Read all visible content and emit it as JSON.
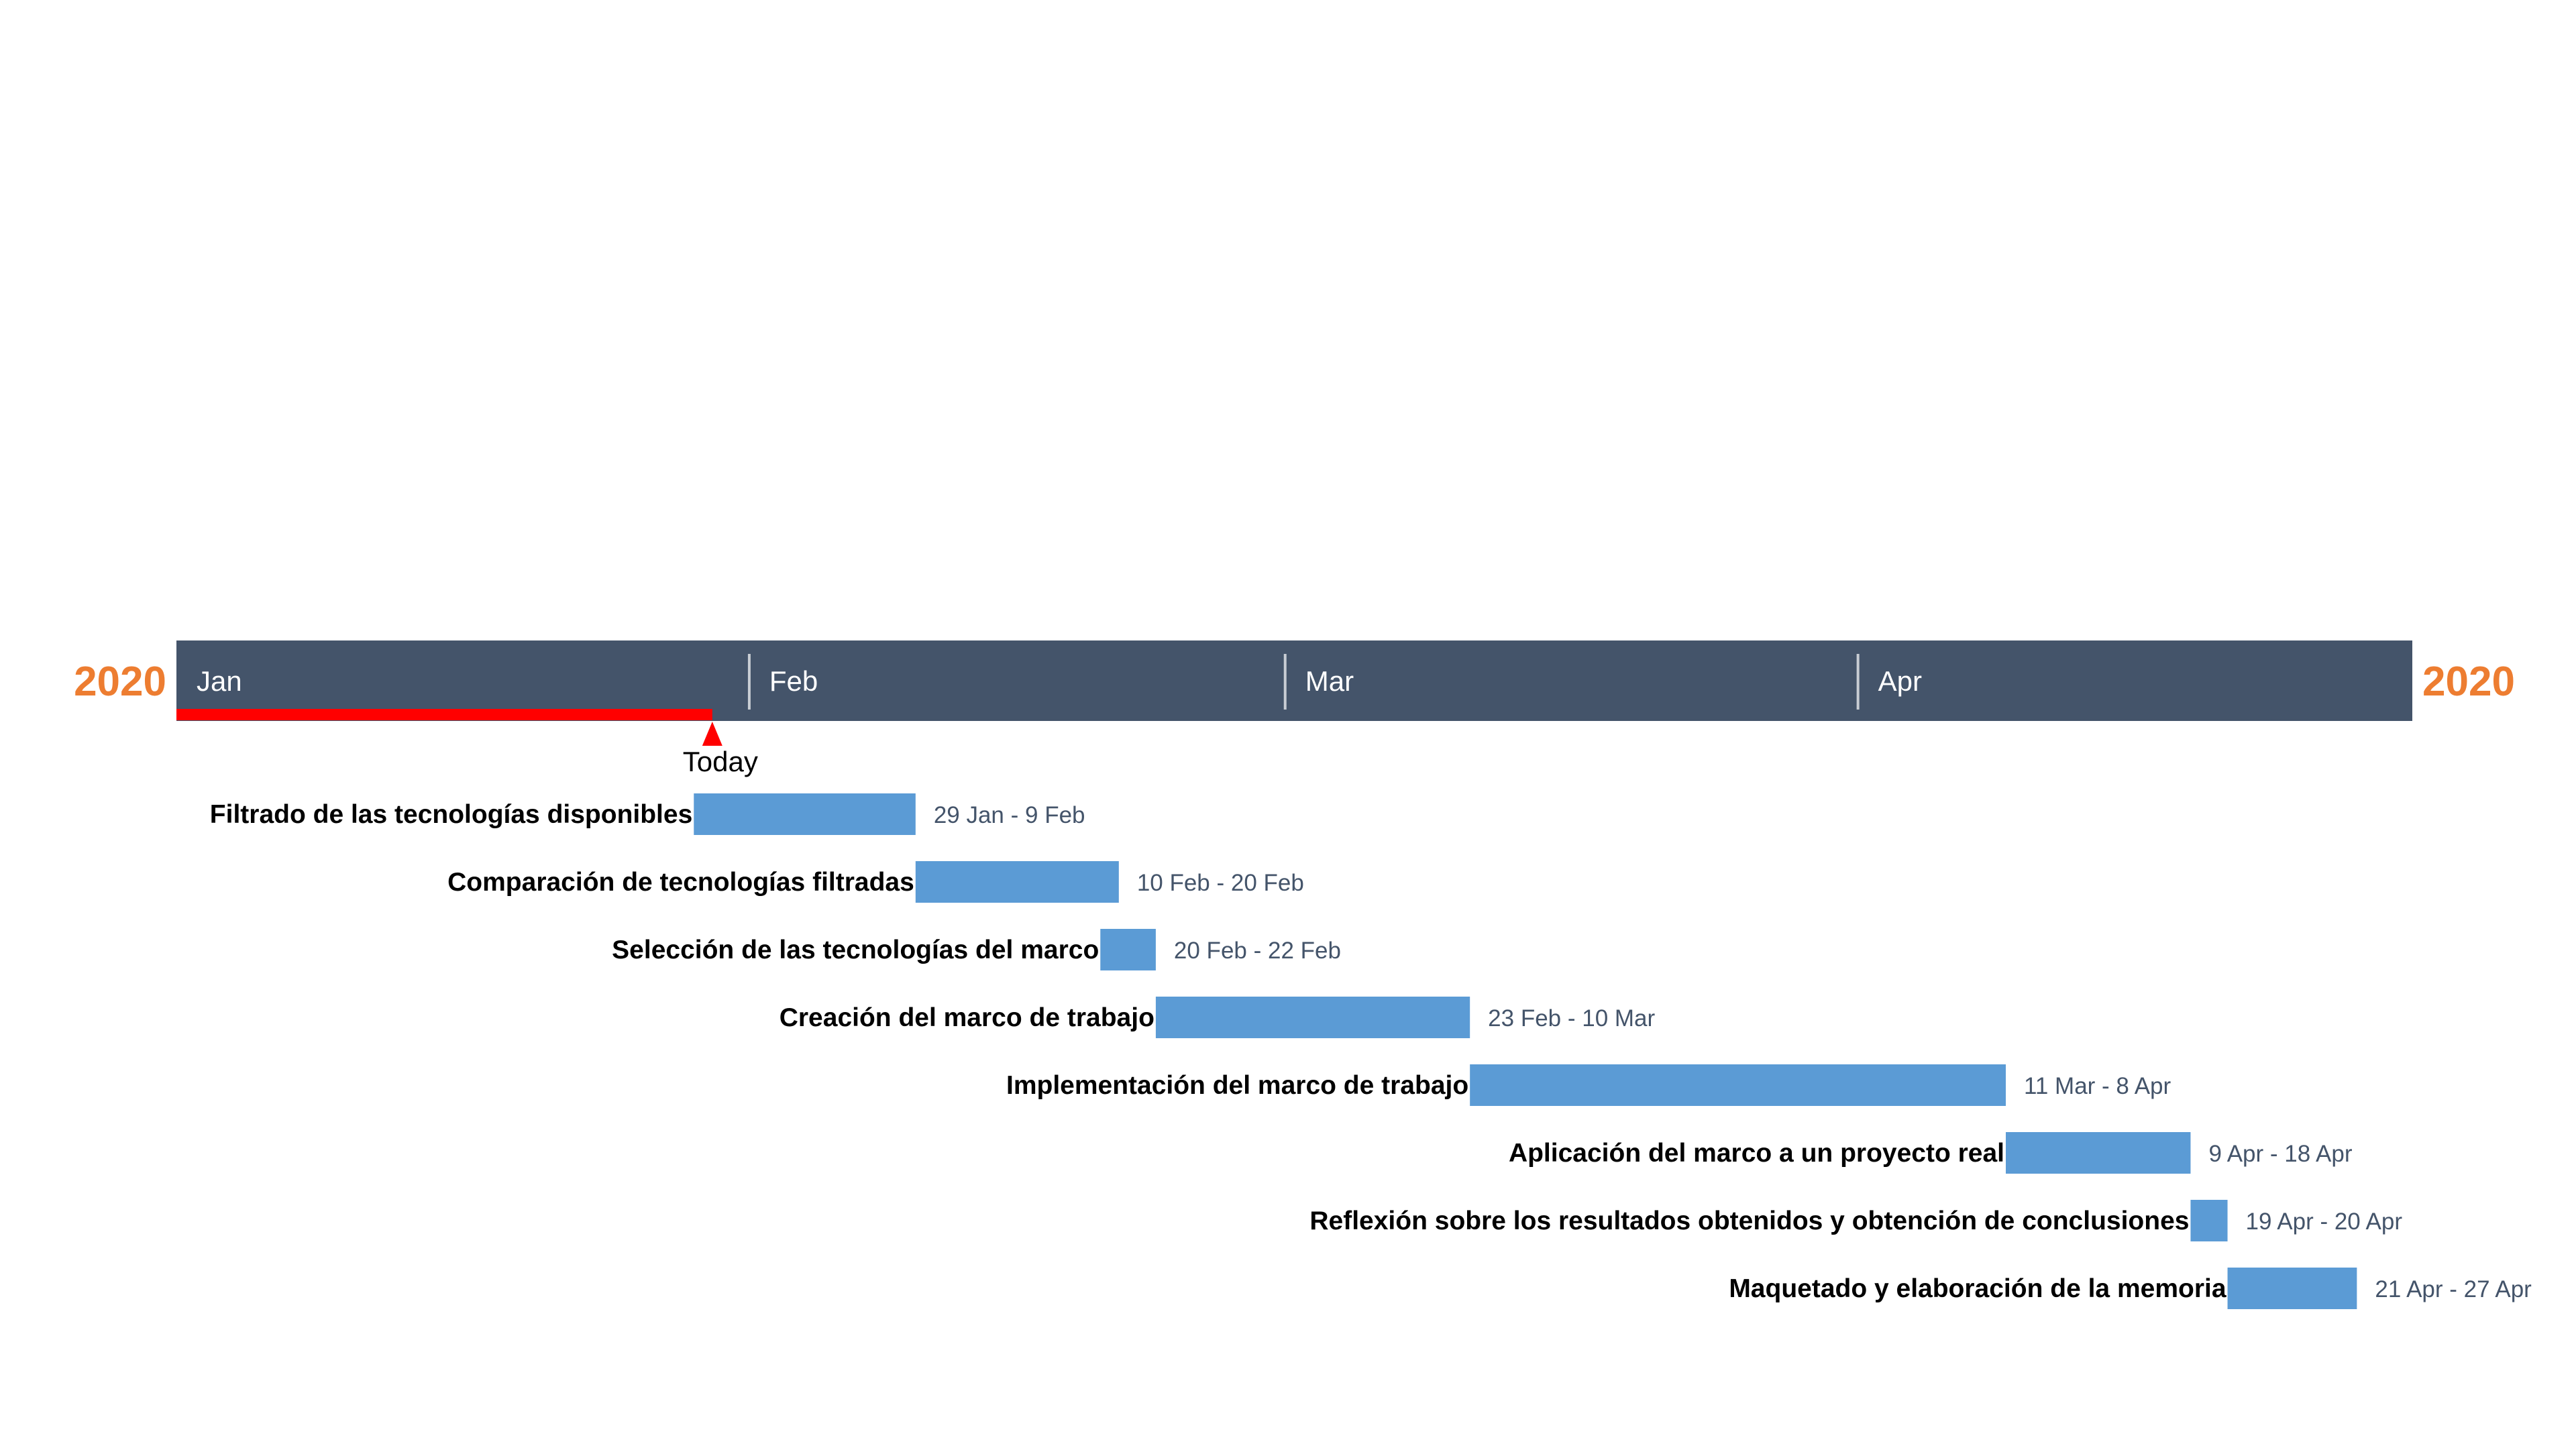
{
  "chart_data": {
    "type": "gantt",
    "year_label": "2020",
    "axis_start": "2020-01-01",
    "axis_end": "2020-04-30",
    "months": [
      "Jan",
      "Feb",
      "Mar",
      "Apr"
    ],
    "today": {
      "label": "Today",
      "date": "2020-01-30"
    },
    "tasks": [
      {
        "name": "Filtrado de las tecnologías disponibles",
        "start": "2020-01-29",
        "end": "2020-02-09",
        "range_label": "29 Jan - 9 Feb"
      },
      {
        "name": "Comparación de tecnologías filtradas",
        "start": "2020-02-10",
        "end": "2020-02-20",
        "range_label": "10 Feb - 20 Feb"
      },
      {
        "name": "Selección de las tecnologías del marco",
        "start": "2020-02-20",
        "end": "2020-02-22",
        "range_label": "20 Feb - 22 Feb"
      },
      {
        "name": "Creación del marco de trabajo",
        "start": "2020-02-23",
        "end": "2020-03-10",
        "range_label": "23 Feb - 10 Mar"
      },
      {
        "name": "Implementación del marco de trabajo",
        "start": "2020-03-11",
        "end": "2020-04-08",
        "range_label": "11 Mar - 8 Apr"
      },
      {
        "name": "Aplicación del marco a un proyecto real",
        "start": "2020-04-09",
        "end": "2020-04-18",
        "range_label": "9 Apr - 18 Apr"
      },
      {
        "name": "Reflexión sobre los resultados obtenidos y obtención de conclusiones",
        "start": "2020-04-19",
        "end": "2020-04-20",
        "range_label": "19 Apr - 20 Apr"
      },
      {
        "name": "Maquetado y elaboración de la memoria",
        "start": "2020-04-21",
        "end": "2020-04-27",
        "range_label": "21 Apr - 27 Apr"
      }
    ],
    "colors": {
      "timeline_band": "#44546a",
      "task_bar": "#5b9bd5",
      "year_text": "#ed7d31",
      "today_marker": "#ff0000",
      "month_text": "#ffffff",
      "range_text": "#44546a",
      "task_text": "#000000"
    }
  }
}
